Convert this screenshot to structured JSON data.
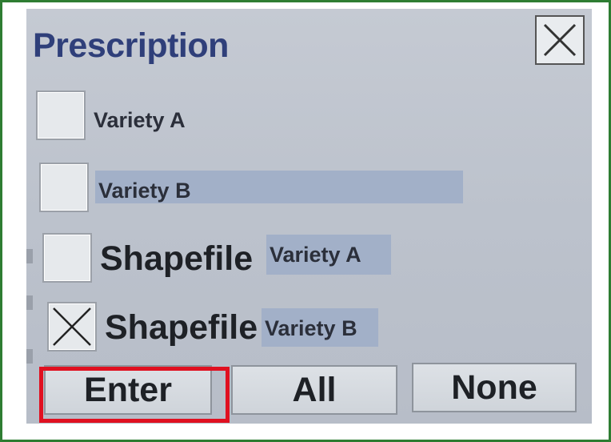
{
  "dialog": {
    "title": "Prescription",
    "close_icon": "close-x-icon"
  },
  "options": [
    {
      "label": "Variety A",
      "checked": false
    },
    {
      "label": "Variety B",
      "checked": false
    },
    {
      "prefix": "Shapefile",
      "label": "Variety A",
      "checked": false
    },
    {
      "prefix": "Shapefile",
      "label": "Variety B",
      "checked": true
    }
  ],
  "buttons": {
    "enter": "Enter",
    "all": "All",
    "none": "None"
  },
  "colors": {
    "frame_border": "#2e7d32",
    "title": "#2f3f7a",
    "label_highlight": "#a2b0c8",
    "annotation_box": "#e01020"
  }
}
